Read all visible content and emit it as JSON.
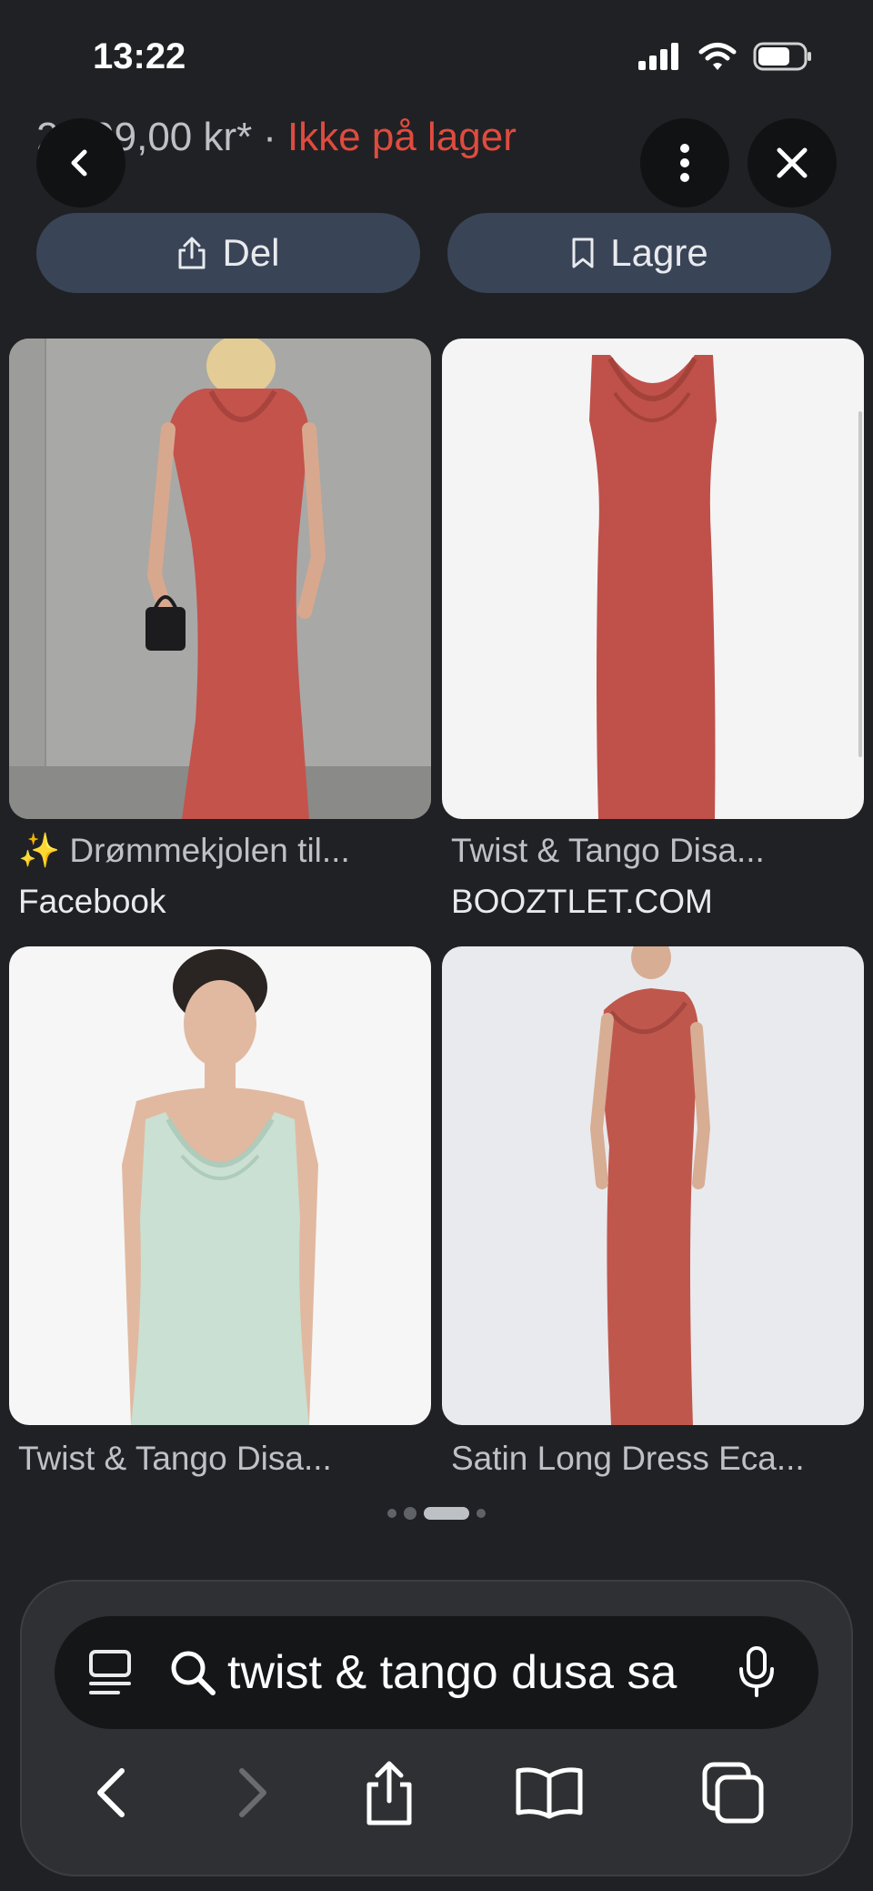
{
  "status_bar": {
    "time": "13:22"
  },
  "header": {
    "price": "2 999,00 kr*",
    "separator": "·",
    "stock_status": "Ikke på lager",
    "stock_color": "#e04b3f"
  },
  "actions": {
    "share_label": "Del",
    "save_label": "Lagre"
  },
  "results": [
    {
      "title": "✨ Drømmekjolen til...",
      "source": "Facebook"
    },
    {
      "title": "Twist & Tango Disa...",
      "source": "BOOZTLET.COM"
    },
    {
      "title": "Twist & Tango Disa...",
      "source": ""
    },
    {
      "title": "Satin Long Dress Eca...",
      "source": ""
    }
  ],
  "address_bar": {
    "query": "twist & tango dusa sa"
  },
  "icons": {
    "back": "chevron-left-icon",
    "more": "vertical-dots-icon",
    "close": "close-icon",
    "share": "share-icon",
    "bookmark": "bookmark-icon",
    "reader": "reader-icon",
    "search": "search-icon",
    "mic": "microphone-icon",
    "forward": "chevron-right-icon",
    "book": "book-icon",
    "tabs": "tabs-icon"
  },
  "colors": {
    "background": "#202124",
    "pill": "#394457",
    "dress_red": "#c4534c",
    "dress_mint": "#c9e0d3"
  }
}
